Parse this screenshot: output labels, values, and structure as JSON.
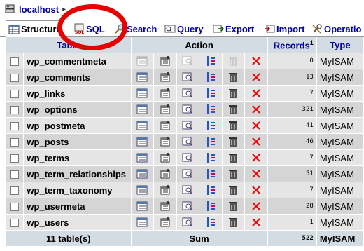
{
  "breadcrumb": {
    "server": "localhost"
  },
  "tabs": [
    {
      "label": "Structure",
      "icon": "structure-icon",
      "active": true
    },
    {
      "label": "SQL",
      "icon": "sql-icon",
      "active": false
    },
    {
      "label": "Search",
      "icon": "search-icon",
      "active": false
    },
    {
      "label": "Query",
      "icon": "query-icon",
      "active": false
    },
    {
      "label": "Export",
      "icon": "export-icon",
      "active": false
    },
    {
      "label": "Import",
      "icon": "import-icon",
      "active": false
    },
    {
      "label": "Operatio",
      "icon": "operations-icon",
      "active": false
    }
  ],
  "table": {
    "headers": {
      "table": "Table",
      "action": "Action",
      "records": "Records",
      "records_note": "1",
      "type": "Type"
    },
    "rows": [
      {
        "name": "wp_commentmeta",
        "records": "0",
        "type": "MyISAM",
        "empty": true
      },
      {
        "name": "wp_comments",
        "records": "13",
        "type": "MyISAM",
        "empty": false
      },
      {
        "name": "wp_links",
        "records": "7",
        "type": "MyISAM",
        "empty": false
      },
      {
        "name": "wp_options",
        "records": "321",
        "type": "MyISAM",
        "empty": false
      },
      {
        "name": "wp_postmeta",
        "records": "41",
        "type": "MyISAM",
        "empty": false
      },
      {
        "name": "wp_posts",
        "records": "46",
        "type": "MyISAM",
        "empty": false
      },
      {
        "name": "wp_terms",
        "records": "7",
        "type": "MyISAM",
        "empty": false
      },
      {
        "name": "wp_term_relationships",
        "records": "51",
        "type": "MyISAM",
        "empty": false
      },
      {
        "name": "wp_term_taxonomy",
        "records": "7",
        "type": "MyISAM",
        "empty": false
      },
      {
        "name": "wp_usermeta",
        "records": "28",
        "type": "MyISAM",
        "empty": false
      },
      {
        "name": "wp_users",
        "records": "1",
        "type": "MyISAM",
        "empty": false
      }
    ],
    "footer": {
      "count": "11 table(s)",
      "sum_label": "Sum",
      "records": "522",
      "type": "MyISAM"
    }
  },
  "colors": {
    "header_bg": "#d3dce3",
    "row_odd": "#e5e5e5",
    "row_even": "#d5d5d5",
    "link": "#0000a0",
    "annotation": "#e60000"
  }
}
